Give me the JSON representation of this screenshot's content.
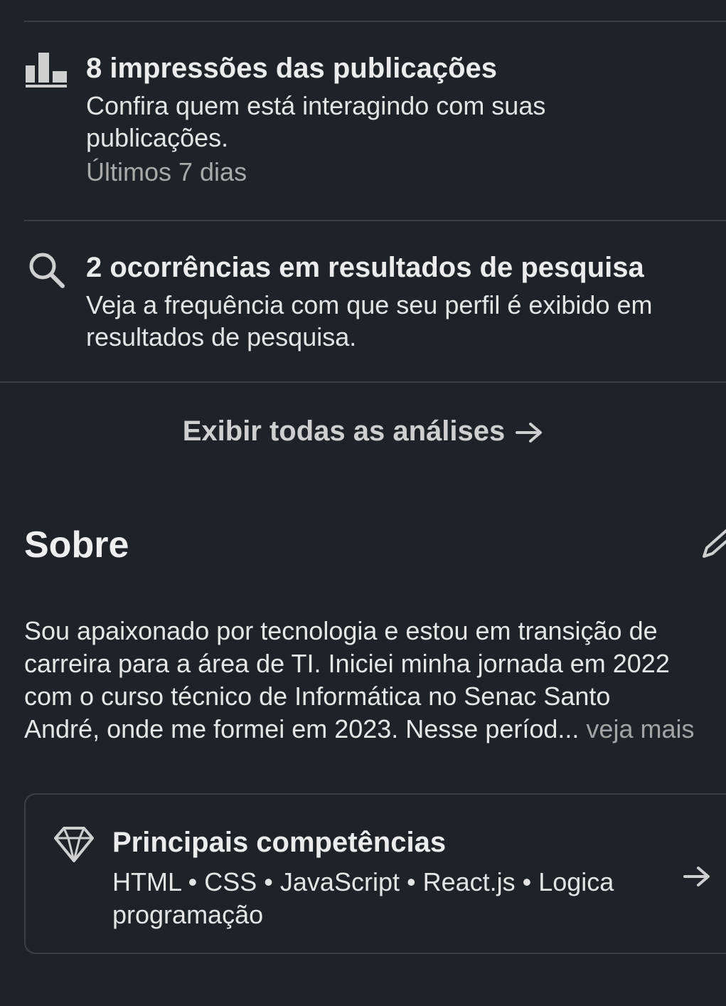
{
  "analytics": {
    "post_impressions": {
      "icon": "bar-chart-icon",
      "title": "8 impressões das publicações",
      "description": "Confira quem está interagindo com suas publicações.",
      "period": "Últimos 7 dias"
    },
    "search_appearances": {
      "icon": "search-icon",
      "title": "2 ocorrências em resultados de pesquisa",
      "description": "Veja a frequência com que seu perfil é exibido em resultados de pesquisa."
    },
    "show_all_label": "Exibir todas as análises"
  },
  "about": {
    "title": "Sobre",
    "lines": [
      "Sou apaixonado por tecnologia e estou em transição de",
      "carreira para a área de TI. Iniciei minha jornada em 2022",
      "com o curso técnico de Informática no Senac Santo",
      "André, onde me formei em 2023. Nesse períod..."
    ],
    "see_more": " veja mais"
  },
  "top_skills": {
    "icon": "diamond-icon",
    "title": "Principais competências",
    "skills": "HTML • CSS • JavaScript • React.js • Logica programação"
  },
  "colors": {
    "background": "#1f2227",
    "divider": "#3a3d42",
    "text_primary": "#ececec",
    "text_secondary": "#a9a9a9"
  }
}
